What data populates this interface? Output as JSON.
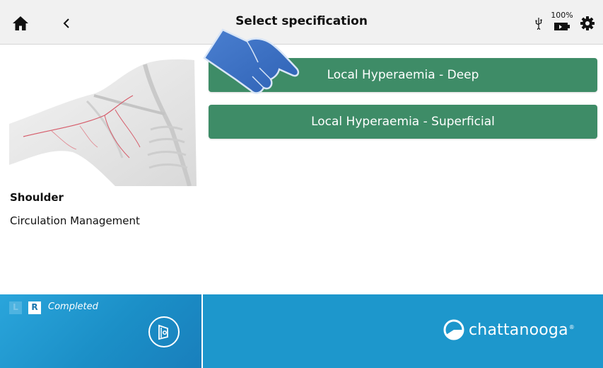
{
  "header": {
    "title": "Select specification",
    "battery_percent": "100%",
    "icons": {
      "home": "home-icon",
      "back": "chevron-left-icon",
      "usb": "usb-icon",
      "battery": "battery-icon",
      "settings": "gear-icon"
    }
  },
  "selection": {
    "body_part": "Shoulder",
    "category": "Circulation Management"
  },
  "specifications": [
    {
      "label": "Local Hyperaemia - Deep"
    },
    {
      "label": "Local Hyperaemia - Superficial"
    }
  ],
  "footer": {
    "side_left": "L",
    "side_right": "R",
    "status": "Completed",
    "brand": "chattanooga",
    "brand_mark": "®",
    "icons": {
      "treatment": "treatment-head-icon",
      "brand_logo": "chattanooga-logo-icon"
    }
  },
  "colors": {
    "button_green": "#3e8c67",
    "footer_blue": "#1d97cc",
    "header_gray": "#f1f1f1"
  }
}
